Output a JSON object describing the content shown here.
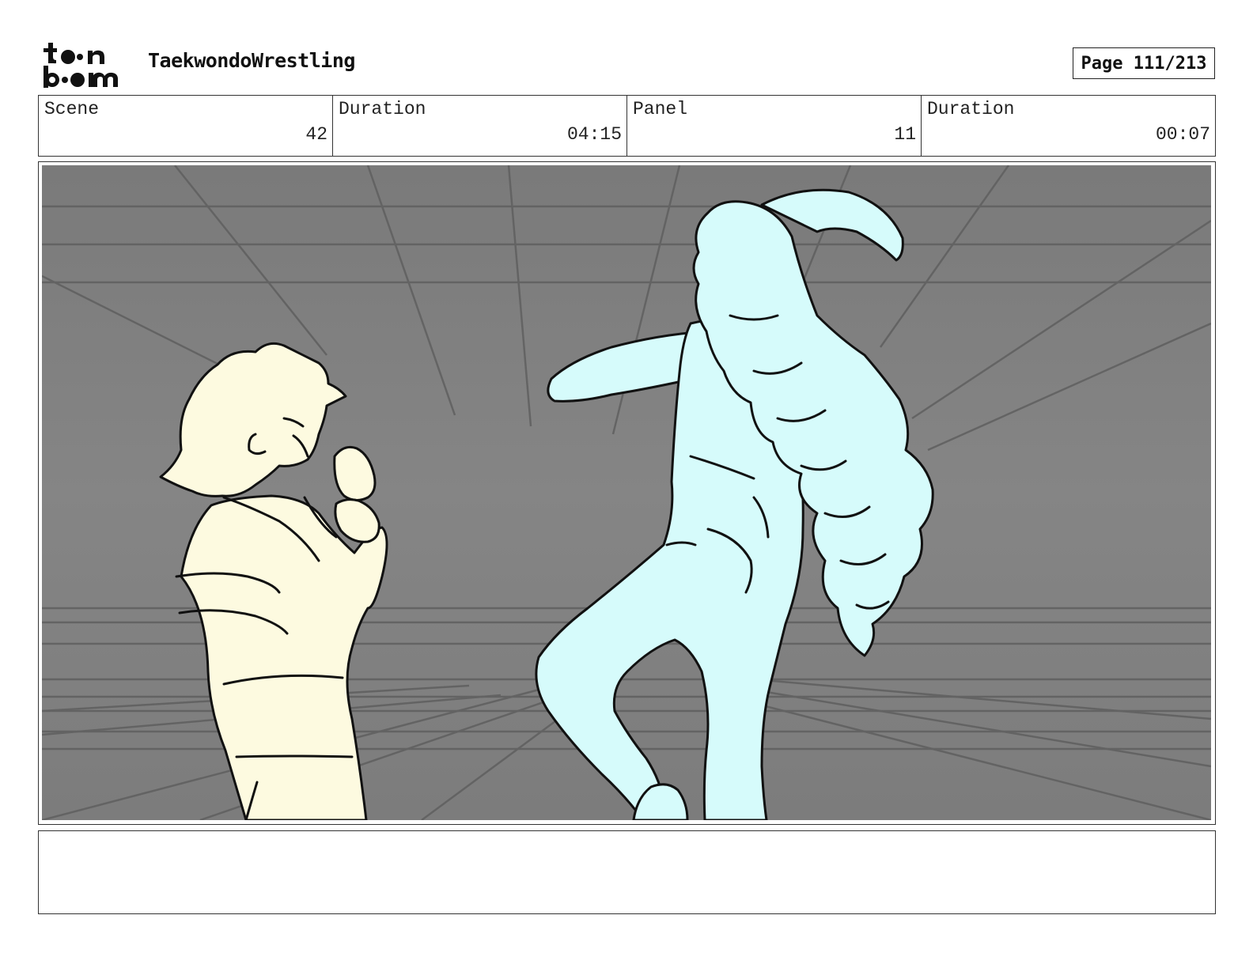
{
  "header": {
    "logo_text": "toon boom",
    "project_title": "TaekwondoWrestling",
    "page_label": "Page 111/213"
  },
  "info": {
    "scene_label": "Scene",
    "scene_value": "42",
    "scene_duration_label": "Duration",
    "scene_duration_value": "04:15",
    "panel_label": "Panel",
    "panel_value": "11",
    "panel_duration_label": "Duration",
    "panel_duration_value": "00:07"
  },
  "colors": {
    "background_gray": "#808080",
    "character_left_fill": "#fdfae0",
    "character_right_fill": "#d6fbfb",
    "line": "#111111"
  },
  "notes": {
    "text": ""
  }
}
